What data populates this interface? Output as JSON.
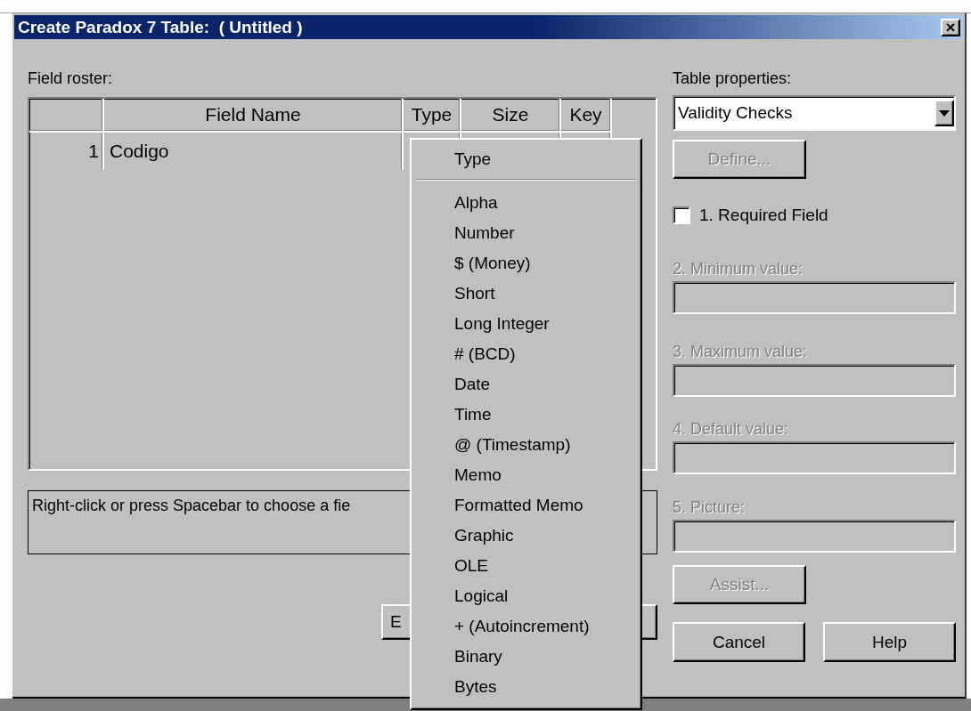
{
  "window": {
    "title": "Create Paradox 7 Table:  ( Untitled )",
    "close": "×"
  },
  "field_roster": {
    "label": "Field roster:",
    "columns": [
      "Field Name",
      "Type",
      "Size",
      "Key"
    ],
    "rows": [
      {
        "number": "1",
        "field_name": "Codigo"
      }
    ]
  },
  "hint": "Right-click or press Spacebar to choose a fie",
  "bottom_buttons": [
    {
      "label": "E"
    }
  ],
  "type_menu": {
    "title": "Type",
    "items": [
      "Alpha",
      "Number",
      "$ (Money)",
      "Short",
      "Long Integer",
      "# (BCD)",
      "Date",
      "Time",
      "@ (Timestamp)",
      "Memo",
      "Formatted Memo",
      "Graphic",
      "OLE",
      "Logical",
      "+ (Autoincrement)",
      "Binary",
      "Bytes"
    ]
  },
  "table_properties": {
    "label": "Table properties:",
    "value": "Validity Checks"
  },
  "define_button": {
    "label": "Define...",
    "disabled": true
  },
  "required_field": {
    "label": "1. Required Field",
    "checked": false
  },
  "fields": [
    {
      "label": "2. Minimum value:",
      "disabled": true
    },
    {
      "label": "3. Maximum value:",
      "disabled": true
    },
    {
      "label": "4. Default value:",
      "disabled": true
    },
    {
      "label": "5. Picture:",
      "disabled": true
    }
  ],
  "assist_button": {
    "label": "Assist...",
    "disabled": true
  },
  "buttons": [
    {
      "label": "Cancel"
    },
    {
      "label": "Help"
    }
  ]
}
